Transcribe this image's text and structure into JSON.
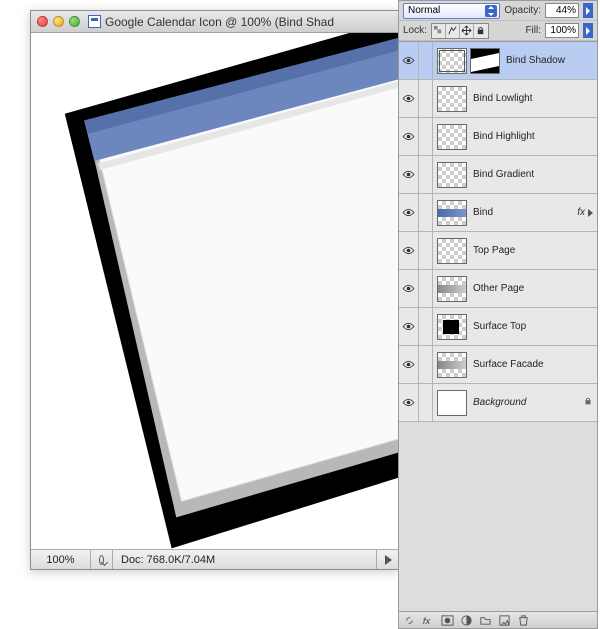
{
  "window": {
    "title": "Google Calendar Icon @ 100% (Bind Shad"
  },
  "statusbar": {
    "zoom": "100%",
    "doc_info": "Doc: 768.0K/7.04M"
  },
  "panel": {
    "blend_mode": "Normal",
    "opacity_label": "Opacity:",
    "opacity_value": "44%",
    "lock_label": "Lock:",
    "fill_label": "Fill:",
    "fill_value": "100%"
  },
  "layers": [
    {
      "name": "Bind Shadow",
      "selected": true,
      "has_mask": true,
      "thumb": "checker-link",
      "fx": false,
      "lock": false,
      "italic": false
    },
    {
      "name": "Bind Lowlight",
      "selected": false,
      "has_mask": false,
      "thumb": "checker",
      "fx": false,
      "lock": false,
      "italic": false
    },
    {
      "name": "Bind Highlight",
      "selected": false,
      "has_mask": false,
      "thumb": "checker",
      "fx": false,
      "lock": false,
      "italic": false
    },
    {
      "name": "Bind Gradient",
      "selected": false,
      "has_mask": false,
      "thumb": "checker",
      "fx": false,
      "lock": false,
      "italic": false
    },
    {
      "name": "Bind",
      "selected": false,
      "has_mask": false,
      "thumb": "gradient-blue",
      "fx": true,
      "lock": false,
      "italic": false
    },
    {
      "name": "Top Page",
      "selected": false,
      "has_mask": false,
      "thumb": "checker",
      "fx": false,
      "lock": false,
      "italic": false
    },
    {
      "name": "Other Page",
      "selected": false,
      "has_mask": false,
      "thumb": "gradient-gray",
      "fx": false,
      "lock": false,
      "italic": false
    },
    {
      "name": "Surface Top",
      "selected": false,
      "has_mask": false,
      "thumb": "black-square",
      "fx": false,
      "lock": false,
      "italic": false
    },
    {
      "name": "Surface Facade",
      "selected": false,
      "has_mask": false,
      "thumb": "gradient-gray",
      "fx": false,
      "lock": false,
      "italic": false
    },
    {
      "name": "Background",
      "selected": false,
      "has_mask": false,
      "thumb": "white",
      "fx": false,
      "lock": true,
      "italic": true
    }
  ],
  "fx_label": "fx"
}
